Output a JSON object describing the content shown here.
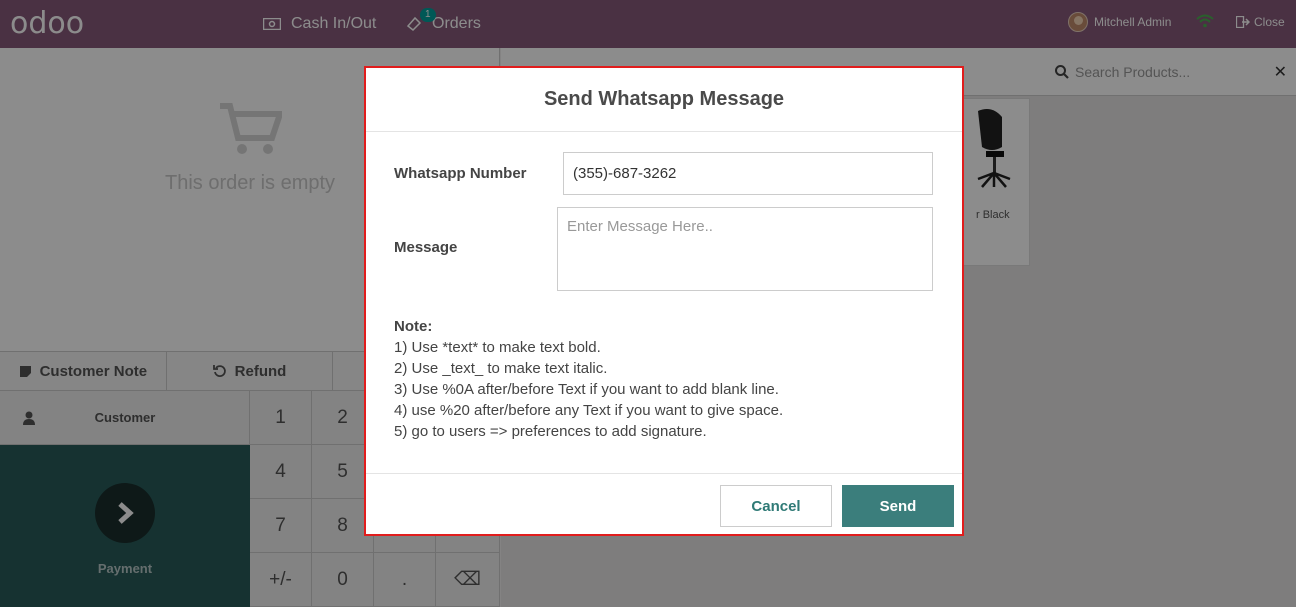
{
  "app": {
    "logo": "odoo"
  },
  "topbar": {
    "cash_label": "Cash In/Out",
    "orders_label": "Orders",
    "orders_count": "1",
    "user_name": "Mitchell Admin",
    "close_label": "Close"
  },
  "order": {
    "empty_text": "This order is empty"
  },
  "actions": {
    "customer_note": "Customer Note",
    "refund": "Refund",
    "customer": "Customer",
    "payment": "Payment"
  },
  "numpad": {
    "keys": [
      "1",
      "2",
      "",
      "",
      "4",
      "5",
      "",
      "",
      "7",
      "8",
      "",
      "",
      "+/-",
      "0",
      ".",
      "⌫"
    ]
  },
  "products": {
    "search_placeholder": "Search Products...",
    "visible_card_text": "r Black"
  },
  "modal": {
    "title": "Send Whatsapp Message",
    "number_label": "Whatsapp Number",
    "number_value": "(355)-687-3262",
    "message_label": "Message",
    "message_placeholder": "Enter Message Here..",
    "note_title": "Note:",
    "notes": [
      "1) Use *text* to make text bold.",
      "2) Use _text_ to make text italic.",
      "3) Use %0A after/before Text if you want to add blank line.",
      "4) use %20 after/before any Text if you want to give space.",
      "5) go to users => preferences to add signature."
    ],
    "cancel_label": "Cancel",
    "send_label": "Send"
  },
  "colors": {
    "topbar": "#875a7b",
    "payment": "#285c5a",
    "send_button": "#3b7e7c",
    "highlight_border": "#e11d1d"
  }
}
